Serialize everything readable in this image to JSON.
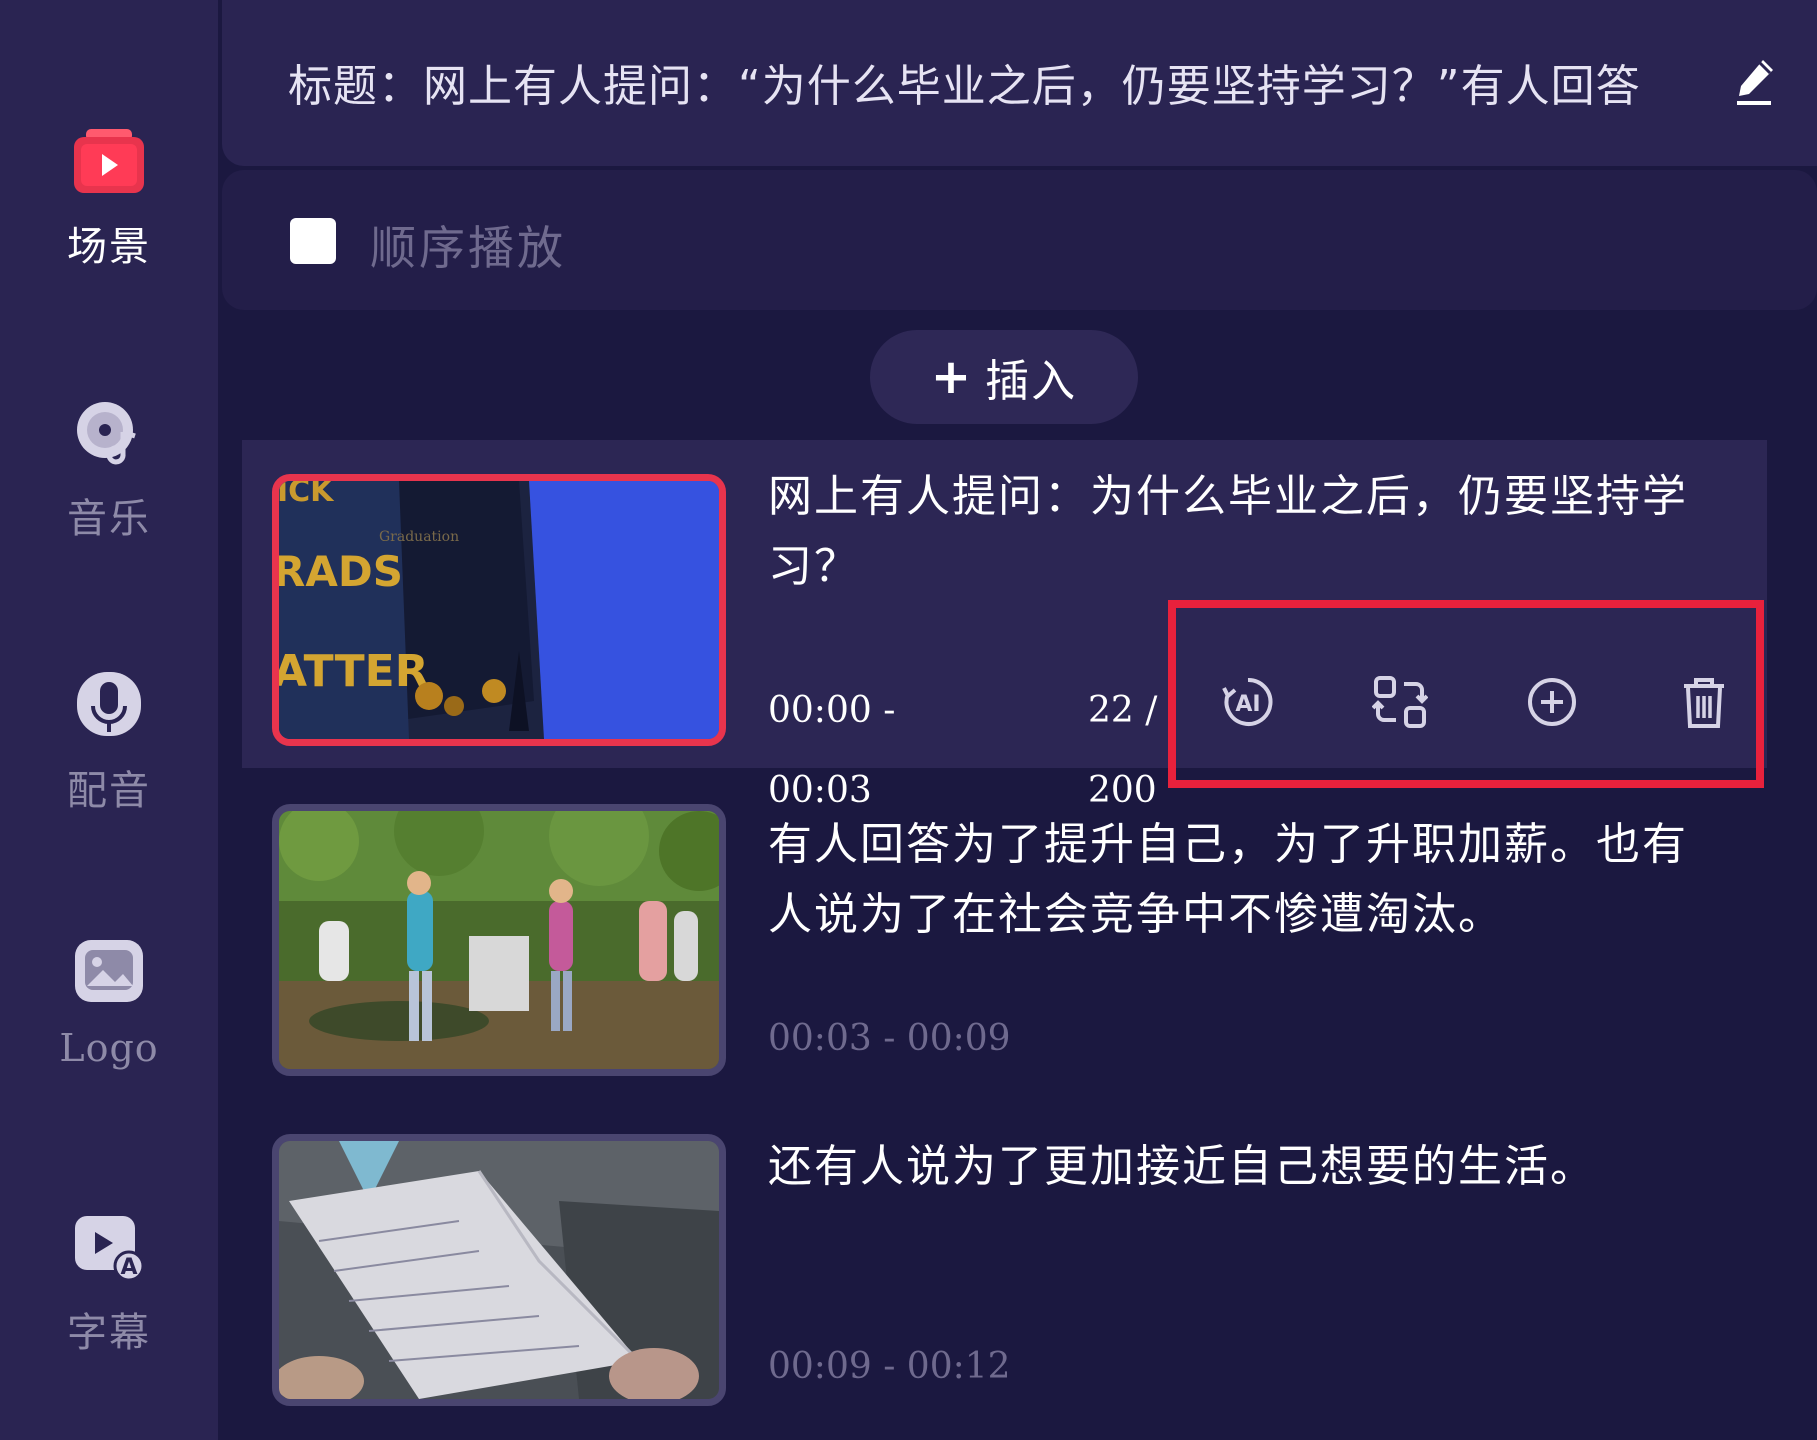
{
  "sidebar": {
    "items": [
      {
        "label": "场景",
        "icon": "scene-icon",
        "active": true
      },
      {
        "label": "音乐",
        "icon": "music-icon",
        "active": false
      },
      {
        "label": "配音",
        "icon": "microphone-icon",
        "active": false
      },
      {
        "label": "Logo",
        "icon": "image-icon",
        "active": false
      },
      {
        "label": "字幕",
        "icon": "subtitle-icon",
        "active": false
      }
    ]
  },
  "title_bar": {
    "text": "标题：网上有人提问：“为什么毕业之后，仍要坚持学习？”有人回答",
    "edit_icon": "pencil-icon"
  },
  "sequential_play": {
    "label": "顺序播放",
    "checked": false
  },
  "insert_button": {
    "plus": "+",
    "label": "插入"
  },
  "scenes": [
    {
      "text": "网上有人提问：为什么毕业之后，仍要坚持学习？",
      "time_start": "00:00 -",
      "time_end": "00:03",
      "count_num": "22 /",
      "count_total": "200",
      "selected": true
    },
    {
      "text": "有人回答为了提升自己，为了升职加薪。也有人说为了在社会竞争中不惨遭淘汰。",
      "time": "00:03 - 00:09",
      "selected": false
    },
    {
      "text": "还有人说为了更加接近自己想要的生活。",
      "time": "00:09 - 00:12",
      "selected": false
    }
  ],
  "scene_actions": [
    {
      "icon": "ai-rewrite-icon"
    },
    {
      "icon": "replace-media-icon"
    },
    {
      "icon": "add-scene-icon"
    },
    {
      "icon": "delete-icon"
    }
  ],
  "colors": {
    "background": "#1b1840",
    "sidebar": "#2a2452",
    "accent_red": "#e8344d",
    "highlight_box": "#e8213c"
  }
}
